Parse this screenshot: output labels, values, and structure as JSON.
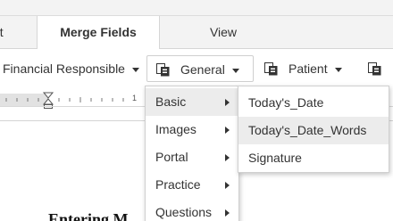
{
  "tabs": [
    {
      "label": "ut",
      "active": false
    },
    {
      "label": "Merge Fields",
      "active": true
    },
    {
      "label": "View",
      "active": false
    }
  ],
  "toolbar": {
    "financial_label": "Financial Responsible",
    "general_label": "General",
    "patient_label": "Patient"
  },
  "ruler": {
    "mark": "1"
  },
  "menu": {
    "items": [
      {
        "label": "Basic",
        "highlighted": true
      },
      {
        "label": "Images"
      },
      {
        "label": "Portal"
      },
      {
        "label": "Practice"
      },
      {
        "label": "Questions"
      }
    ]
  },
  "submenu": {
    "items": [
      {
        "label": "Today's_Date"
      },
      {
        "label": "Today's_Date_Words",
        "highlighted": true
      },
      {
        "label": "Signature"
      }
    ]
  },
  "document": {
    "heading": "Entering M"
  },
  "colors": {
    "hover": "#ececec",
    "border": "#d0d0d0",
    "tab_bar": "#f3f3f3"
  }
}
